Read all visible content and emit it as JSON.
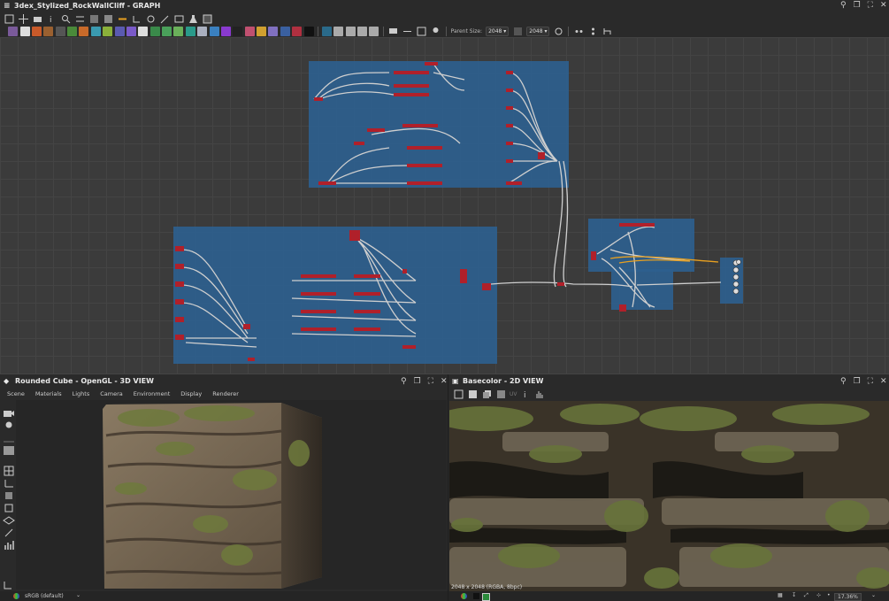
{
  "graph_window": {
    "title": "3dex_Stylized_RockWallCliff - GRAPH",
    "parent_size_label": "Parent Size:",
    "parent_size_value": "2048",
    "output_size_value": "2048"
  },
  "view3d": {
    "title": "Rounded Cube - OpenGL - 3D VIEW",
    "menu": [
      "Scene",
      "Materials",
      "Lights",
      "Camera",
      "Environment",
      "Display",
      "Renderer"
    ],
    "colorspace": "sRGB (default)"
  },
  "view2d": {
    "title": "Basecolor - 2D VIEW",
    "uv_label": "UV",
    "image_info": "2048 x 2048 (RGBA, 8bpc)",
    "zoom": "17.36%"
  },
  "colors": {
    "frame_blue": "#2e5f8e",
    "node_red": "#b0202a",
    "link_gray": "#cfcfcf",
    "link_orange": "#e8a020"
  }
}
